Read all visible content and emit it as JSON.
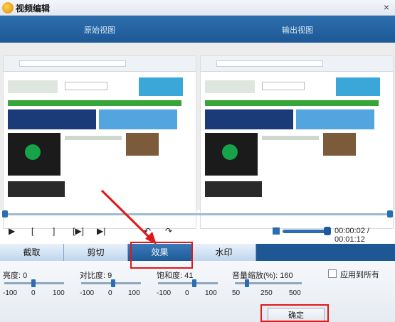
{
  "window": {
    "title": "视频编辑",
    "close": "×"
  },
  "views": {
    "original": "原始视图",
    "output": "输出视图"
  },
  "controls": {
    "play": "▶",
    "mark_in": "[",
    "mark_out": "]",
    "next_frame": "[▶]",
    "step": "▶|",
    "rotate_left": "↶",
    "rotate_right": "↷",
    "time": "00:00:02 / 00:01:12",
    "volume_level": 0.85
  },
  "tabs": [
    "截取",
    "剪切",
    "效果",
    "水印"
  ],
  "active_tab": 2,
  "settings": {
    "brightness": {
      "label": "亮度: 0",
      "min": "-100",
      "mid": "0",
      "max": "100"
    },
    "contrast": {
      "label": "对比度: 9",
      "min": "-100",
      "mid": "0",
      "max": "100"
    },
    "saturation": {
      "label": "饱和度: 41",
      "min": "-100",
      "mid": "0",
      "max": "100"
    },
    "volume_scale": {
      "label": "音量缩放(%): 160",
      "min": "50",
      "mid": "250",
      "max": "500"
    },
    "apply_all": "应用到所有"
  },
  "ok_button": "确定",
  "colors": {
    "accent": "#1d5895",
    "highlight": "#e01818"
  }
}
